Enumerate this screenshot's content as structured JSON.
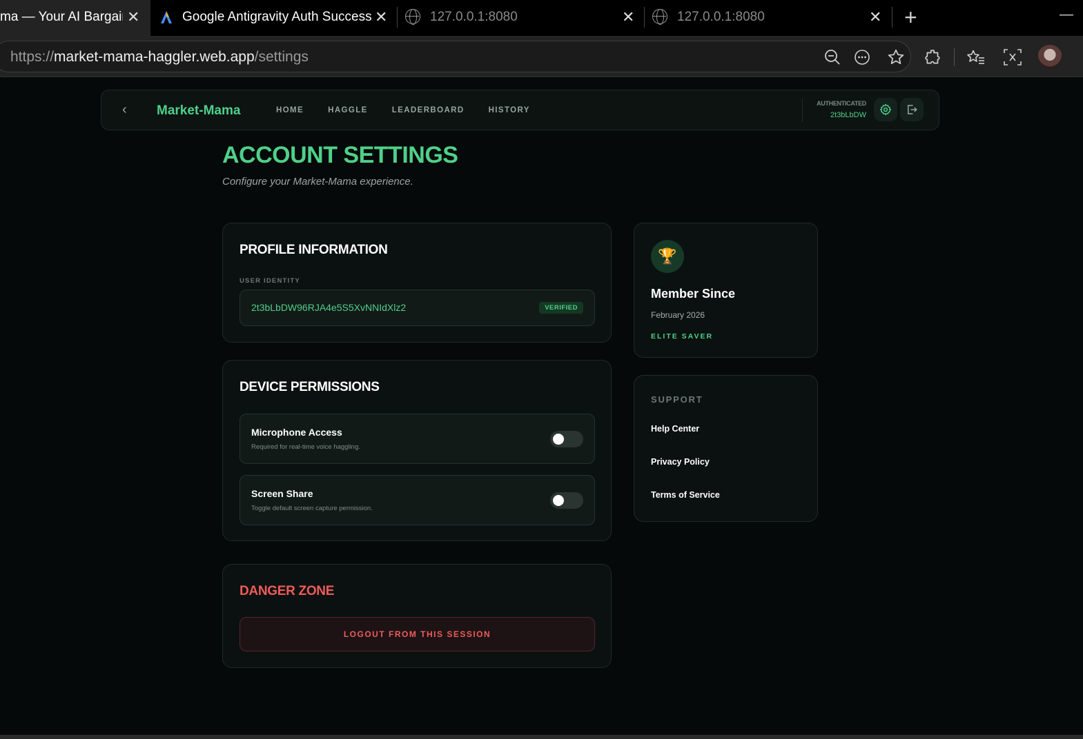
{
  "browser": {
    "tabs": [
      {
        "title": "ma — Your AI Bargainin",
        "close": "✕"
      },
      {
        "title": "Google Antigravity Auth Success",
        "close": "✕"
      },
      {
        "title": "127.0.0.1:8080",
        "close": "✕"
      },
      {
        "title": "127.0.0.1:8080",
        "close": "✕"
      }
    ],
    "new_tab": "+",
    "minimize": "—",
    "url_scheme": "https://",
    "url_host": "market-mama-haggler.web.app",
    "url_path": "/settings"
  },
  "nav": {
    "back": "‹",
    "brand": "Market-Mama",
    "links": [
      "HOME",
      "HAGGLE",
      "LEADERBOARD",
      "HISTORY"
    ],
    "auth_label": "AUTHENTICATED",
    "auth_id": "2t3bLbDW"
  },
  "page": {
    "title": "ACCOUNT SETTINGS",
    "subtitle": "Configure your Market-Mama experience."
  },
  "profile": {
    "heading": "PROFILE INFORMATION",
    "field_label": "USER IDENTITY",
    "user_id": "2t3bLbDW96RJA4e5S5XvNNIdXlz2",
    "badge": "VERIFIED"
  },
  "permissions": {
    "heading": "DEVICE PERMISSIONS",
    "items": [
      {
        "title": "Microphone Access",
        "desc": "Required for real-time voice haggling.",
        "enabled": false
      },
      {
        "title": "Screen Share",
        "desc": "Toggle default screen capture permission.",
        "enabled": false
      }
    ]
  },
  "danger": {
    "heading": "DANGER ZONE",
    "button": "LOGOUT FROM THIS SESSION"
  },
  "member": {
    "icon": "🏆",
    "title": "Member Since",
    "date": "February 2026",
    "rank": "ELITE SAVER"
  },
  "support": {
    "heading": "SUPPORT",
    "links": [
      "Help Center",
      "Privacy Policy",
      "Terms of Service"
    ]
  },
  "colors": {
    "accent": "#4fd08a",
    "danger": "#ef5b5b",
    "background": "#060909",
    "card": "#0b1110"
  }
}
